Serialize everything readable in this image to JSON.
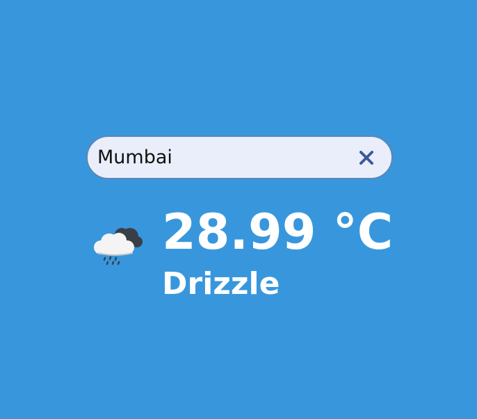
{
  "search": {
    "value": "Mumbai",
    "clear_icon": "close-icon"
  },
  "weather": {
    "icon": "rain-cloud-icon",
    "temperature": "28.99 °C",
    "condition": "Drizzle"
  },
  "colors": {
    "background": "#3897dc",
    "search_background": "#e9eefa",
    "search_border": "#5a86b8",
    "clear_icon": "#3c5a99",
    "text": "#ffffff"
  }
}
